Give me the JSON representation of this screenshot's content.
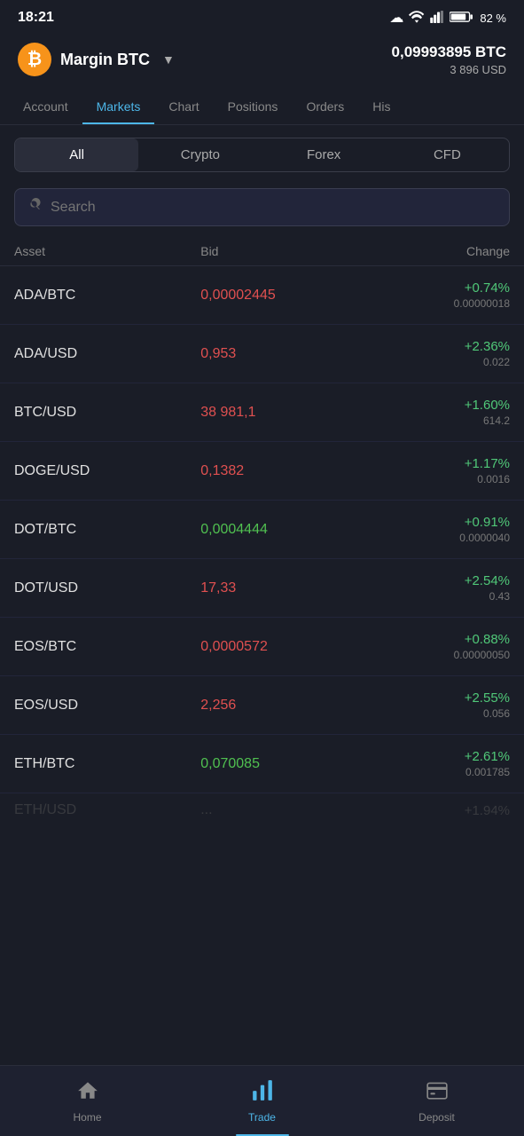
{
  "statusBar": {
    "time": "18:21",
    "battery": "82 %"
  },
  "header": {
    "accountName": "Margin BTC",
    "balanceBtc": "0,09993895 BTC",
    "balanceUsd": "3 896 USD"
  },
  "navTabs": [
    {
      "label": "Account",
      "active": false
    },
    {
      "label": "Markets",
      "active": true
    },
    {
      "label": "Chart",
      "active": false
    },
    {
      "label": "Positions",
      "active": false
    },
    {
      "label": "Orders",
      "active": false
    },
    {
      "label": "His",
      "active": false
    }
  ],
  "filters": [
    {
      "label": "All",
      "active": true
    },
    {
      "label": "Crypto",
      "active": false
    },
    {
      "label": "Forex",
      "active": false
    },
    {
      "label": "CFD",
      "active": false
    }
  ],
  "search": {
    "placeholder": "Search"
  },
  "tableHeaders": {
    "asset": "Asset",
    "bid": "Bid",
    "change": "Change"
  },
  "markets": [
    {
      "asset": "ADA/BTC",
      "bid": "0,00002445",
      "bidColor": "red",
      "changePct": "+0.74%",
      "changeAbs": "0.00000018"
    },
    {
      "asset": "ADA/USD",
      "bid": "0,953",
      "bidColor": "red",
      "changePct": "+2.36%",
      "changeAbs": "0.022"
    },
    {
      "asset": "BTC/USD",
      "bid": "38 981,1",
      "bidColor": "red",
      "changePct": "+1.60%",
      "changeAbs": "614.2"
    },
    {
      "asset": "DOGE/USD",
      "bid": "0,1382",
      "bidColor": "red",
      "changePct": "+1.17%",
      "changeAbs": "0.0016"
    },
    {
      "asset": "DOT/BTC",
      "bid": "0,0004444",
      "bidColor": "green",
      "changePct": "+0.91%",
      "changeAbs": "0.0000040"
    },
    {
      "asset": "DOT/USD",
      "bid": "17,33",
      "bidColor": "red",
      "changePct": "+2.54%",
      "changeAbs": "0.43"
    },
    {
      "asset": "EOS/BTC",
      "bid": "0,0000572",
      "bidColor": "red",
      "changePct": "+0.88%",
      "changeAbs": "0.00000050"
    },
    {
      "asset": "EOS/USD",
      "bid": "2,256",
      "bidColor": "red",
      "changePct": "+2.55%",
      "changeAbs": "0.056"
    },
    {
      "asset": "ETH/BTC",
      "bid": "0,070085",
      "bidColor": "green",
      "changePct": "+2.61%",
      "changeAbs": "0.001785"
    }
  ],
  "bottomNav": [
    {
      "label": "Home",
      "icon": "home",
      "active": false
    },
    {
      "label": "Trade",
      "icon": "trade",
      "active": true
    },
    {
      "label": "Deposit",
      "icon": "deposit",
      "active": false
    }
  ]
}
